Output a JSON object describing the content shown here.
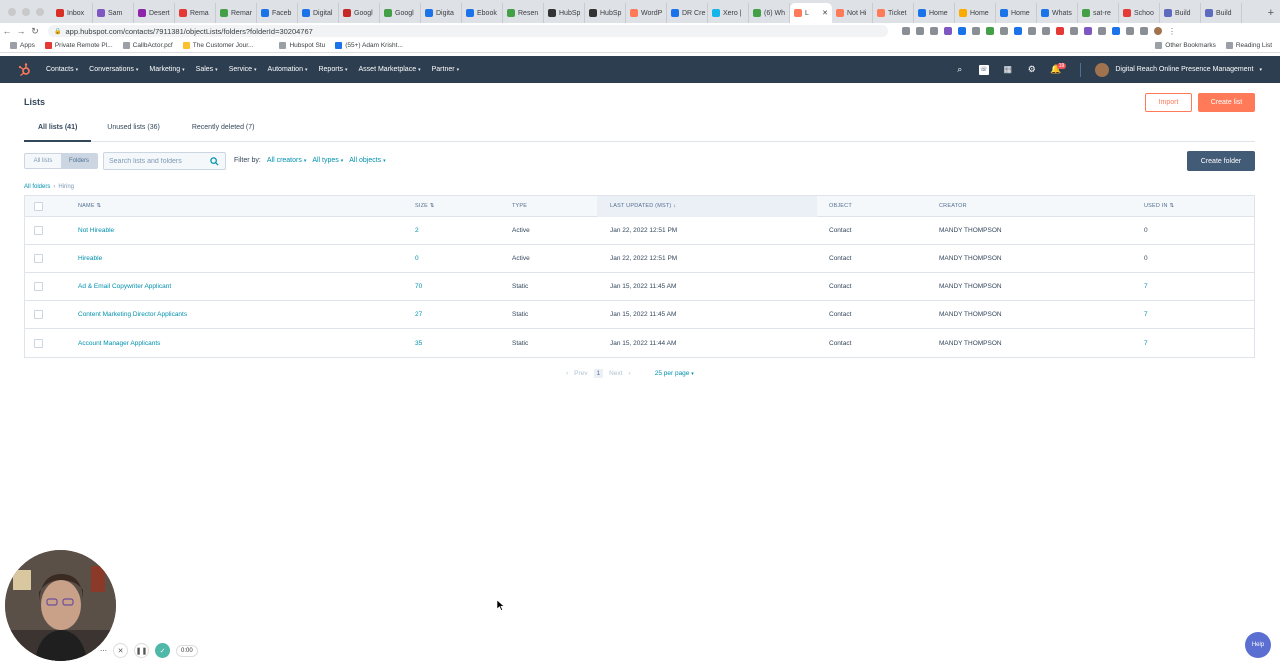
{
  "browser": {
    "tabs": [
      {
        "label": "Inbox",
        "color": "#d93025"
      },
      {
        "label": "Sam",
        "color": "#7e57c2"
      },
      {
        "label": "Desert",
        "color": "#8e24aa"
      },
      {
        "label": "Rema",
        "color": "#e53935"
      },
      {
        "label": "Remar",
        "color": "#43a047"
      },
      {
        "label": "Faceb",
        "color": "#1a73e8"
      },
      {
        "label": "Digital",
        "color": "#1a73e8"
      },
      {
        "label": "Googl",
        "color": "#c62828"
      },
      {
        "label": "Googl",
        "color": "#43a047"
      },
      {
        "label": "Digita",
        "color": "#1a73e8"
      },
      {
        "label": "Ebook",
        "color": "#1a73e8"
      },
      {
        "label": "Resen",
        "color": "#43a047"
      },
      {
        "label": "HubSp",
        "color": "#333333"
      },
      {
        "label": "HubSp",
        "color": "#333333"
      },
      {
        "label": "WordP",
        "color": "#ff7a59"
      },
      {
        "label": "DR Cre",
        "color": "#1a73e8"
      },
      {
        "label": "Xero |",
        "color": "#13b5ea"
      },
      {
        "label": "(6) Wh",
        "color": "#43a047"
      },
      {
        "label": "L",
        "color": "#ff7a59",
        "active": true
      },
      {
        "label": "Not Hi",
        "color": "#ff7a59"
      },
      {
        "label": "Ticket",
        "color": "#ff7a59"
      },
      {
        "label": "Home",
        "color": "#1a73e8"
      },
      {
        "label": "Home",
        "color": "#f9ab00"
      },
      {
        "label": "Home",
        "color": "#1a73e8"
      },
      {
        "label": "Whats",
        "color": "#1a73e8"
      },
      {
        "label": "sat-re",
        "color": "#43a047"
      },
      {
        "label": "Schoo",
        "color": "#e53935"
      },
      {
        "label": "Build",
        "color": "#5c6bc0"
      },
      {
        "label": "Build",
        "color": "#5c6bc0"
      }
    ],
    "url": "app.hubspot.com/contacts/7911381/objectLists/folders?folderId=30204767",
    "bookmarks": [
      "Apps",
      "Private Remote Pl...",
      "CallbActor.pcf",
      "The Customer Jour...",
      "Hubspot Stu",
      "(55+) Adam Krisht...",
      "Other Bookmarks",
      "Reading List"
    ]
  },
  "nav": {
    "items": [
      "Contacts",
      "Conversations",
      "Marketing",
      "Sales",
      "Service",
      "Automation",
      "Reports",
      "Asset Marketplace",
      "Partner"
    ],
    "notifications": "19",
    "account": "Digital Reach Online Presence Management"
  },
  "page": {
    "title": "Lists",
    "import_label": "Import",
    "create_list_label": "Create list",
    "tabs": [
      "All lists (41)",
      "Unused lists (36)",
      "Recently deleted (7)"
    ],
    "view_toggle": [
      "All lists",
      "Folders"
    ],
    "search_placeholder": "Search lists and folders",
    "filter_by": "Filter by:",
    "filters": [
      "All creators",
      "All types",
      "All objects"
    ],
    "create_folder_label": "Create folder",
    "breadcrumb": {
      "root": "All folders",
      "current": "Hiring"
    }
  },
  "table": {
    "columns": [
      "NAME",
      "SIZE",
      "TYPE",
      "LAST UPDATED (MST)",
      "OBJECT",
      "CREATOR",
      "USED IN"
    ],
    "rows": [
      {
        "name": "Not Hireable",
        "size": "2",
        "type": "Active",
        "updated": "Jan 22, 2022 12:51 PM",
        "object": "Contact",
        "creator": "MANDY THOMPSON",
        "used_in": "0"
      },
      {
        "name": "Hireable",
        "size": "0",
        "type": "Active",
        "updated": "Jan 22, 2022 12:51 PM",
        "object": "Contact",
        "creator": "MANDY THOMPSON",
        "used_in": "0"
      },
      {
        "name": "Ad & Email Copywriter Applicant",
        "size": "70",
        "type": "Static",
        "updated": "Jan 15, 2022 11:45 AM",
        "object": "Contact",
        "creator": "MANDY THOMPSON",
        "used_in": "7"
      },
      {
        "name": "Content Marketing Director Applicants",
        "size": "27",
        "type": "Static",
        "updated": "Jan 15, 2022 11:45 AM",
        "object": "Contact",
        "creator": "MANDY THOMPSON",
        "used_in": "7"
      },
      {
        "name": "Account Manager Applicants",
        "size": "35",
        "type": "Static",
        "updated": "Jan 15, 2022 11:44 AM",
        "object": "Contact",
        "creator": "MANDY THOMPSON",
        "used_in": "7"
      }
    ]
  },
  "pagination": {
    "prev": "Prev",
    "page": "1",
    "next": "Next",
    "per_page": "25 per page"
  },
  "recorder": {
    "time": "0:00"
  },
  "help_label": "Help",
  "colors": {
    "accent": "#ff7a59",
    "nav_bg": "#2d3e50",
    "link": "#0091ae"
  }
}
